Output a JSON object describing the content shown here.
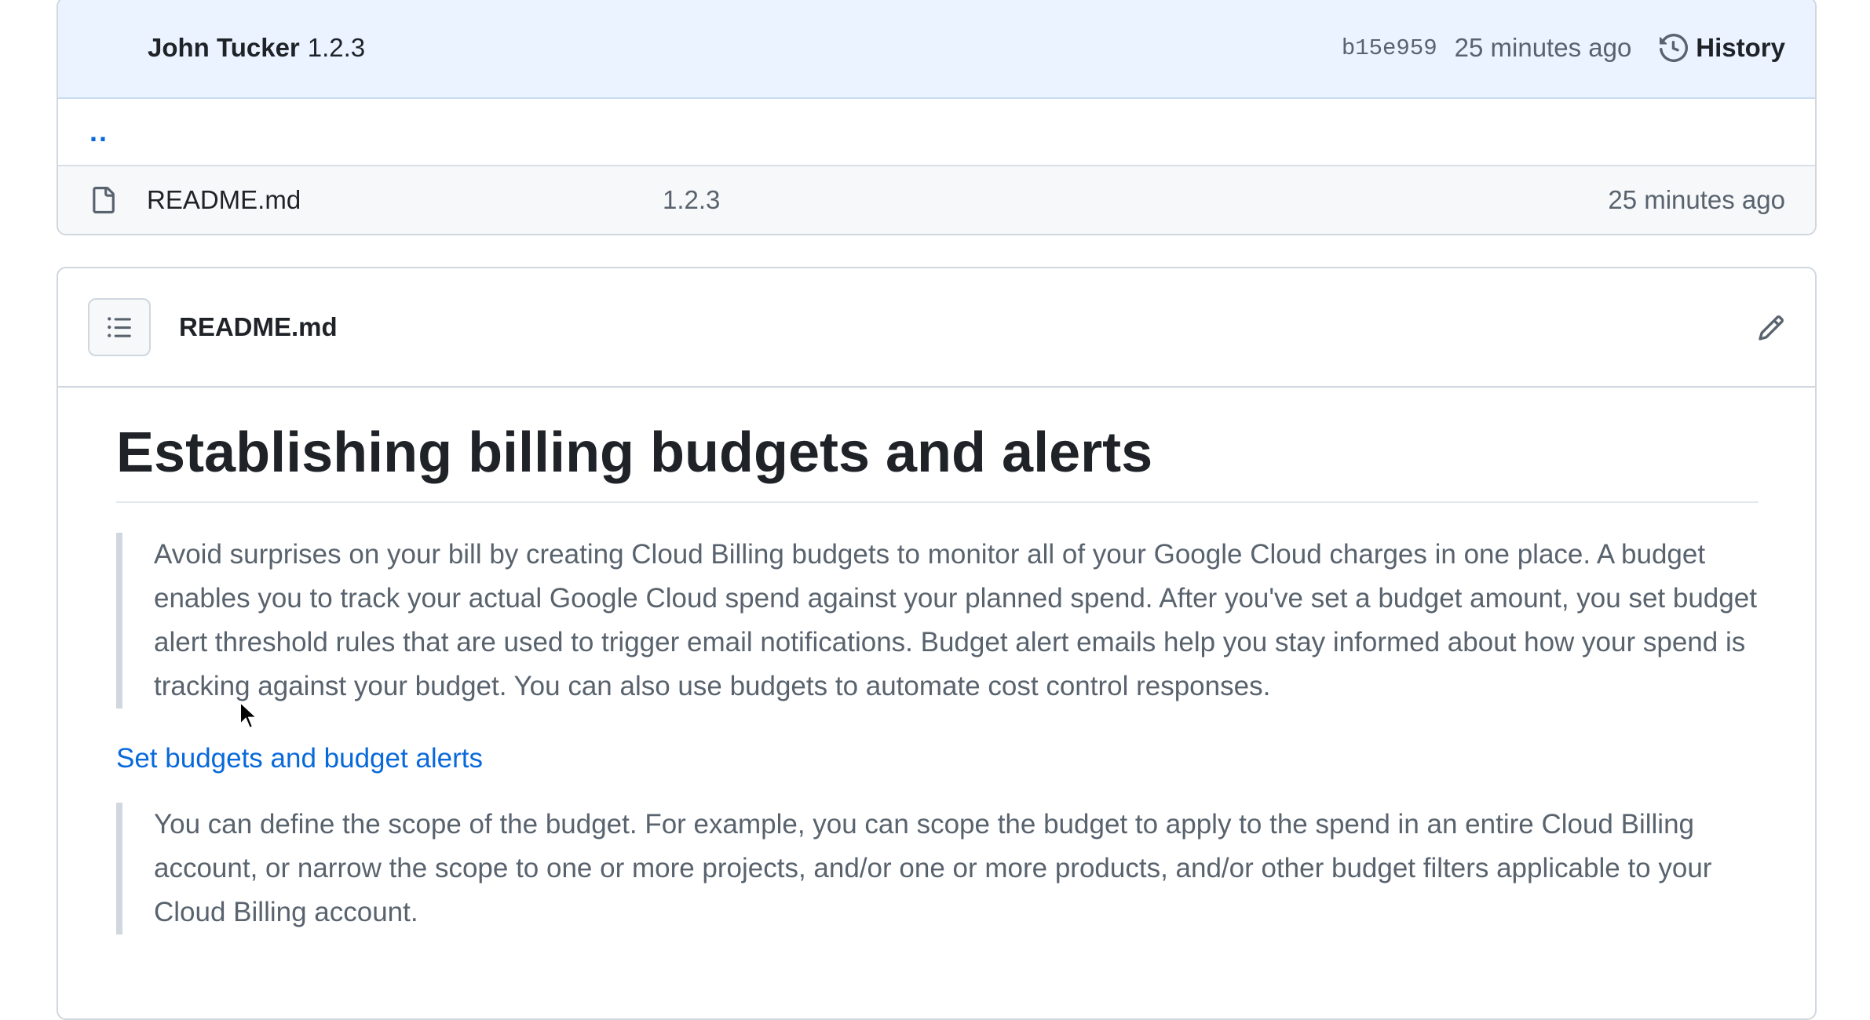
{
  "commit_bar": {
    "author": "John Tucker",
    "message": "1.2.3",
    "sha": "b15e959",
    "time": "25 minutes ago",
    "history_label": "History"
  },
  "parent_dir": "..",
  "files": [
    {
      "name": "README.md",
      "message": "1.2.3",
      "time": "25 minutes ago",
      "icon": "file-icon"
    }
  ],
  "readme": {
    "header_title": "README.md",
    "heading": "Establishing billing budgets and alerts",
    "quote1": "Avoid surprises on your bill by creating Cloud Billing budgets to monitor all of your Google Cloud charges in one place. A budget enables you to track your actual Google Cloud spend against your planned spend. After you've set a budget amount, you set budget alert threshold rules that are used to trigger email notifications. Budget alert emails help you stay informed about how your spend is tracking against your budget. You can also use budgets to automate cost control responses.",
    "link": "Set budgets and budget alerts",
    "quote2": "You can define the scope of the budget. For example, you can scope the budget to apply to the spend in an entire Cloud Billing account, or narrow the scope to one or more projects, and/or one or more products, and/or other budget filters applicable to your Cloud Billing account."
  },
  "colors": {
    "link": "#0969da",
    "commit_bar_bg": "#eaf3ff",
    "muted_text": "#59636e",
    "border": "#d0d7de"
  },
  "icons": {
    "history": "history-icon",
    "toc": "list-unordered-icon",
    "edit": "pencil-icon",
    "cursor": "mouse-pointer-icon"
  }
}
